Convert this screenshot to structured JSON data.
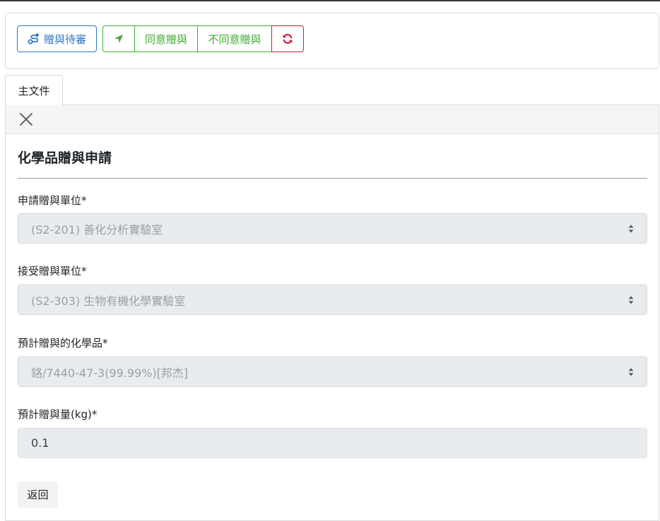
{
  "toolbar": {
    "pending_label": "贈與待審",
    "agree_label": "同意贈與",
    "reject_label": "不同意贈與"
  },
  "tabs": [
    {
      "label": "主文件"
    }
  ],
  "form": {
    "title": "化學品贈與申請",
    "fields": [
      {
        "label": "申請贈與單位*",
        "value": "(S2-201) 善化分析實驗室",
        "type": "select"
      },
      {
        "label": "接受贈與單位*",
        "value": "(S2-303) 生物有機化學實驗室",
        "type": "select"
      },
      {
        "label": "預計贈與的化學品*",
        "value": "鉻/7440-47-3(99.99%)[邦杰]",
        "type": "select"
      },
      {
        "label": "預計贈與量(kg)*",
        "value": "0.1",
        "type": "input"
      }
    ],
    "back_label": "返回"
  },
  "colors": {
    "primary": "#2e75c6",
    "success": "#3fab33",
    "danger": "#d9183b"
  },
  "icons": {
    "pending": "route-icon",
    "send": "location-arrow-icon",
    "refresh": "refresh-icon",
    "close": "close-icon",
    "select_caret": "sort-caret-icon"
  }
}
